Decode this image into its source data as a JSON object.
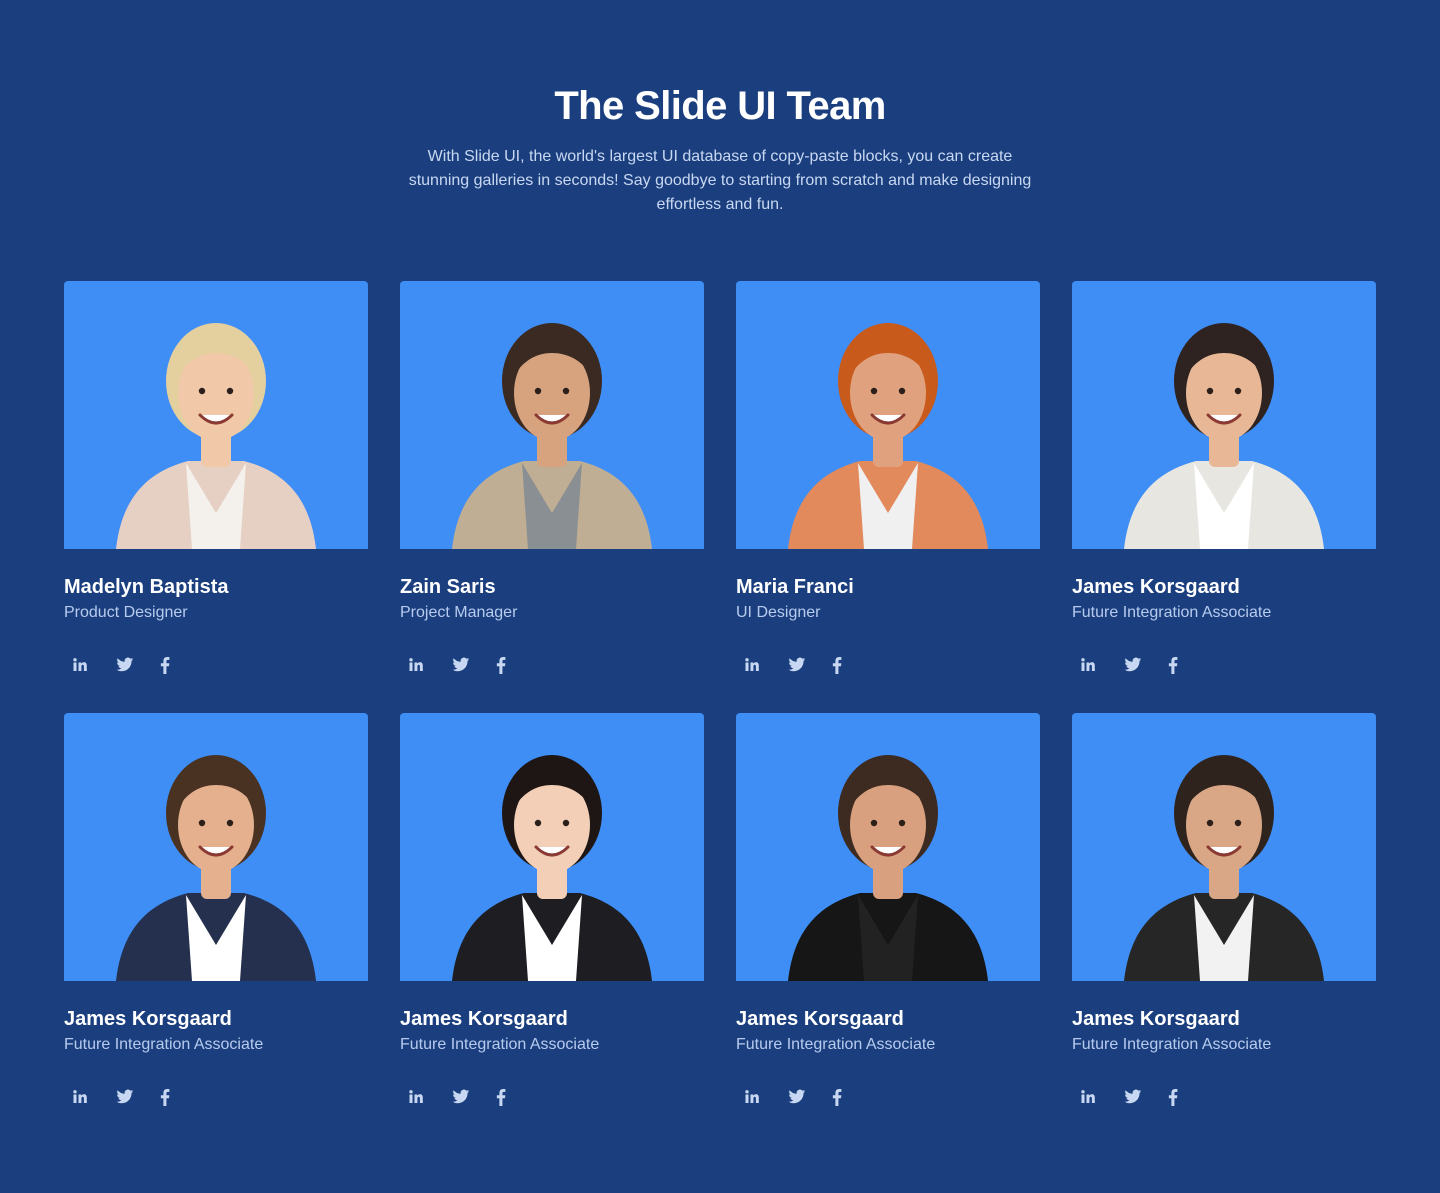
{
  "header": {
    "title": "The Slide UI Team",
    "subtitle": "With Slide UI, the world's largest UI database of copy-paste blocks, you can create stunning galleries in seconds! Say goodbye to starting from scratch and make designing effortless and fun."
  },
  "colors": {
    "background": "#1b3f7e",
    "photo_background": "#3f8ef5",
    "role_text": "#b7cbee",
    "icon": "#c8d8f2"
  },
  "socials": [
    "linkedin-icon",
    "twitter-icon",
    "facebook-icon"
  ],
  "members": [
    {
      "name": "Madelyn Baptista",
      "role": "Product Designer",
      "skin": "#f1c9a8",
      "hair": "#e4cf9f",
      "top": "#f4f1ec",
      "jacket": "#e6cfc3"
    },
    {
      "name": "Zain Saris",
      "role": "Project Manager",
      "skin": "#d7a37f",
      "hair": "#3b2a21",
      "top": "#8a8f93",
      "jacket": "#bfae93"
    },
    {
      "name": "Maria Franci",
      "role": "UI Designer",
      "skin": "#e0a27e",
      "hair": "#c85a1c",
      "top": "#f0f0f0",
      "jacket": "#e38a5c"
    },
    {
      "name": "James Korsgaard",
      "role": "Future Integration Associate",
      "skin": "#e7b796",
      "hair": "#2e2320",
      "top": "#ffffff",
      "jacket": "#e8e6e1"
    },
    {
      "name": "James Korsgaard",
      "role": "Future Integration Associate",
      "skin": "#e4b08e",
      "hair": "#4a3222",
      "top": "#ffffff",
      "jacket": "#24304d"
    },
    {
      "name": "James Korsgaard",
      "role": "Future Integration Associate",
      "skin": "#f2cfb6",
      "hair": "#1e1614",
      "top": "#ffffff",
      "jacket": "#1d1d22"
    },
    {
      "name": "James Korsgaard",
      "role": "Future Integration Associate",
      "skin": "#d8a07e",
      "hair": "#3d2a20",
      "top": "#222222",
      "jacket": "#161616"
    },
    {
      "name": "James Korsgaard",
      "role": "Future Integration Associate",
      "skin": "#d9a786",
      "hair": "#2f231d",
      "top": "#f2f2f2",
      "jacket": "#262626"
    }
  ]
}
